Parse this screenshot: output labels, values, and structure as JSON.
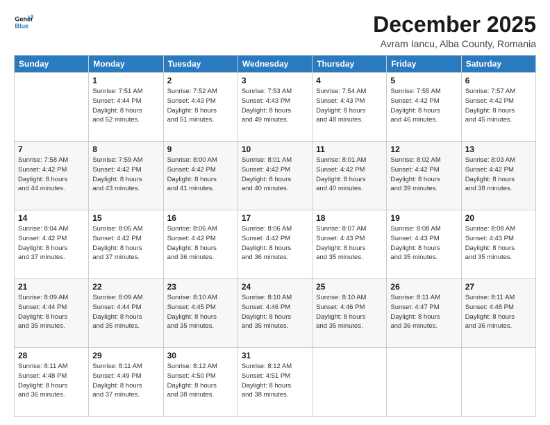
{
  "header": {
    "logo_line1": "General",
    "logo_line2": "Blue",
    "title": "December 2025",
    "subtitle": "Avram Iancu, Alba County, Romania"
  },
  "weekdays": [
    "Sunday",
    "Monday",
    "Tuesday",
    "Wednesday",
    "Thursday",
    "Friday",
    "Saturday"
  ],
  "weeks": [
    [
      {
        "day": "",
        "info": ""
      },
      {
        "day": "1",
        "info": "Sunrise: 7:51 AM\nSunset: 4:44 PM\nDaylight: 8 hours\nand 52 minutes."
      },
      {
        "day": "2",
        "info": "Sunrise: 7:52 AM\nSunset: 4:43 PM\nDaylight: 8 hours\nand 51 minutes."
      },
      {
        "day": "3",
        "info": "Sunrise: 7:53 AM\nSunset: 4:43 PM\nDaylight: 8 hours\nand 49 minutes."
      },
      {
        "day": "4",
        "info": "Sunrise: 7:54 AM\nSunset: 4:43 PM\nDaylight: 8 hours\nand 48 minutes."
      },
      {
        "day": "5",
        "info": "Sunrise: 7:55 AM\nSunset: 4:42 PM\nDaylight: 8 hours\nand 46 minutes."
      },
      {
        "day": "6",
        "info": "Sunrise: 7:57 AM\nSunset: 4:42 PM\nDaylight: 8 hours\nand 45 minutes."
      }
    ],
    [
      {
        "day": "7",
        "info": "Sunrise: 7:58 AM\nSunset: 4:42 PM\nDaylight: 8 hours\nand 44 minutes."
      },
      {
        "day": "8",
        "info": "Sunrise: 7:59 AM\nSunset: 4:42 PM\nDaylight: 8 hours\nand 43 minutes."
      },
      {
        "day": "9",
        "info": "Sunrise: 8:00 AM\nSunset: 4:42 PM\nDaylight: 8 hours\nand 41 minutes."
      },
      {
        "day": "10",
        "info": "Sunrise: 8:01 AM\nSunset: 4:42 PM\nDaylight: 8 hours\nand 40 minutes."
      },
      {
        "day": "11",
        "info": "Sunrise: 8:01 AM\nSunset: 4:42 PM\nDaylight: 8 hours\nand 40 minutes."
      },
      {
        "day": "12",
        "info": "Sunrise: 8:02 AM\nSunset: 4:42 PM\nDaylight: 8 hours\nand 39 minutes."
      },
      {
        "day": "13",
        "info": "Sunrise: 8:03 AM\nSunset: 4:42 PM\nDaylight: 8 hours\nand 38 minutes."
      }
    ],
    [
      {
        "day": "14",
        "info": "Sunrise: 8:04 AM\nSunset: 4:42 PM\nDaylight: 8 hours\nand 37 minutes."
      },
      {
        "day": "15",
        "info": "Sunrise: 8:05 AM\nSunset: 4:42 PM\nDaylight: 8 hours\nand 37 minutes."
      },
      {
        "day": "16",
        "info": "Sunrise: 8:06 AM\nSunset: 4:42 PM\nDaylight: 8 hours\nand 36 minutes."
      },
      {
        "day": "17",
        "info": "Sunrise: 8:06 AM\nSunset: 4:42 PM\nDaylight: 8 hours\nand 36 minutes."
      },
      {
        "day": "18",
        "info": "Sunrise: 8:07 AM\nSunset: 4:43 PM\nDaylight: 8 hours\nand 35 minutes."
      },
      {
        "day": "19",
        "info": "Sunrise: 8:08 AM\nSunset: 4:43 PM\nDaylight: 8 hours\nand 35 minutes."
      },
      {
        "day": "20",
        "info": "Sunrise: 8:08 AM\nSunset: 4:43 PM\nDaylight: 8 hours\nand 35 minutes."
      }
    ],
    [
      {
        "day": "21",
        "info": "Sunrise: 8:09 AM\nSunset: 4:44 PM\nDaylight: 8 hours\nand 35 minutes."
      },
      {
        "day": "22",
        "info": "Sunrise: 8:09 AM\nSunset: 4:44 PM\nDaylight: 8 hours\nand 35 minutes."
      },
      {
        "day": "23",
        "info": "Sunrise: 8:10 AM\nSunset: 4:45 PM\nDaylight: 8 hours\nand 35 minutes."
      },
      {
        "day": "24",
        "info": "Sunrise: 8:10 AM\nSunset: 4:46 PM\nDaylight: 8 hours\nand 35 minutes."
      },
      {
        "day": "25",
        "info": "Sunrise: 8:10 AM\nSunset: 4:46 PM\nDaylight: 8 hours\nand 35 minutes."
      },
      {
        "day": "26",
        "info": "Sunrise: 8:11 AM\nSunset: 4:47 PM\nDaylight: 8 hours\nand 36 minutes."
      },
      {
        "day": "27",
        "info": "Sunrise: 8:11 AM\nSunset: 4:48 PM\nDaylight: 8 hours\nand 36 minutes."
      }
    ],
    [
      {
        "day": "28",
        "info": "Sunrise: 8:11 AM\nSunset: 4:48 PM\nDaylight: 8 hours\nand 36 minutes."
      },
      {
        "day": "29",
        "info": "Sunrise: 8:11 AM\nSunset: 4:49 PM\nDaylight: 8 hours\nand 37 minutes."
      },
      {
        "day": "30",
        "info": "Sunrise: 8:12 AM\nSunset: 4:50 PM\nDaylight: 8 hours\nand 38 minutes."
      },
      {
        "day": "31",
        "info": "Sunrise: 8:12 AM\nSunset: 4:51 PM\nDaylight: 8 hours\nand 38 minutes."
      },
      {
        "day": "",
        "info": ""
      },
      {
        "day": "",
        "info": ""
      },
      {
        "day": "",
        "info": ""
      }
    ]
  ]
}
